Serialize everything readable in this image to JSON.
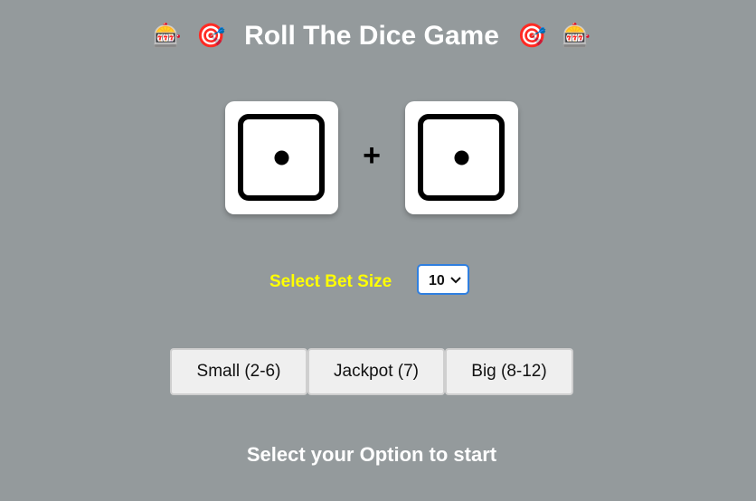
{
  "header": {
    "title": "Roll The Dice Game",
    "left_icons": [
      "slot-machine-icon",
      "dart-target-icon"
    ],
    "right_icons": [
      "dart-target-icon",
      "slot-machine-icon"
    ],
    "slot_emoji": "🎰",
    "target_emoji": "🎯"
  },
  "dice": {
    "die1": 1,
    "die2": 1,
    "operator": "+"
  },
  "bet": {
    "label": "Select Bet Size",
    "value": "10"
  },
  "options": {
    "small": "Small (2-6)",
    "jackpot": "Jackpot (7)",
    "big": "Big (8-12)"
  },
  "status": {
    "message": "Select your Option to start"
  },
  "colors": {
    "background": "#949a9c",
    "bet_label": "#ffff00",
    "select_border": "#2f7fe0"
  }
}
